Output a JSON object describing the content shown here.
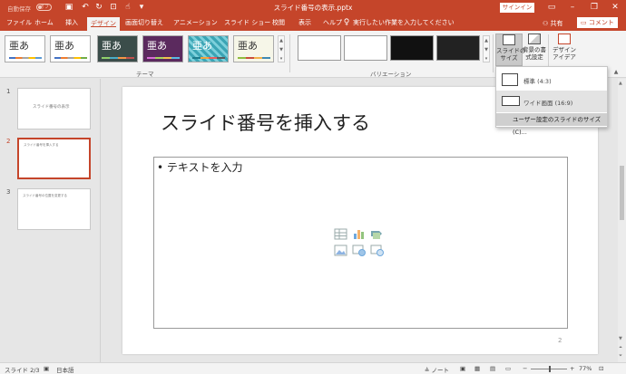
{
  "titlebar": {
    "autosave_label": "自動保存",
    "autosave_state": "オフ",
    "doc_title": "スライド番号の表示.pptx",
    "signin_label": "サインイン",
    "bg_color": "#c5452a"
  },
  "tabs": [
    {
      "label": "ファイル"
    },
    {
      "label": "ホーム"
    },
    {
      "label": "挿入"
    },
    {
      "label": "デザイン"
    },
    {
      "label": "画面切り替え"
    },
    {
      "label": "アニメーション"
    },
    {
      "label": "スライド ショー"
    },
    {
      "label": "校閲"
    },
    {
      "label": "表示"
    },
    {
      "label": "ヘルプ"
    }
  ],
  "active_tab": "デザイン",
  "tell_me": "実行したい作業を入力してください",
  "share_label": "共有",
  "comment_label": "コメント",
  "ribbon": {
    "themes_group_label": "テーマ",
    "variations_group_label": "バリエーション",
    "theme_glyph": "亜あ",
    "slide_size_button": "スライドの\nサイズ",
    "format_bg_button": "背景の書\n式設定",
    "design_ideas_button": "デザイン\nアイデア"
  },
  "slide_size_menu": {
    "items": [
      {
        "label": "標準 (4:3)"
      },
      {
        "label": "ワイド画面 (16:9)"
      }
    ],
    "custom_label": "ユーザー設定のスライドのサイズ(C)..."
  },
  "slides": [
    {
      "number": "1",
      "text": "スライド番号の表示"
    },
    {
      "number": "2",
      "text": "スライド番号を挿入する"
    },
    {
      "number": "3",
      "text": "スライド番号の位置を変更する"
    }
  ],
  "current_slide": {
    "title": "スライド番号を挿入する",
    "bullet": "• テキストを入力",
    "page_number": "2"
  },
  "statusbar": {
    "slide_info": "スライド 2/3",
    "language": "日本語",
    "notes_label": "ノート",
    "zoom": "77%"
  }
}
